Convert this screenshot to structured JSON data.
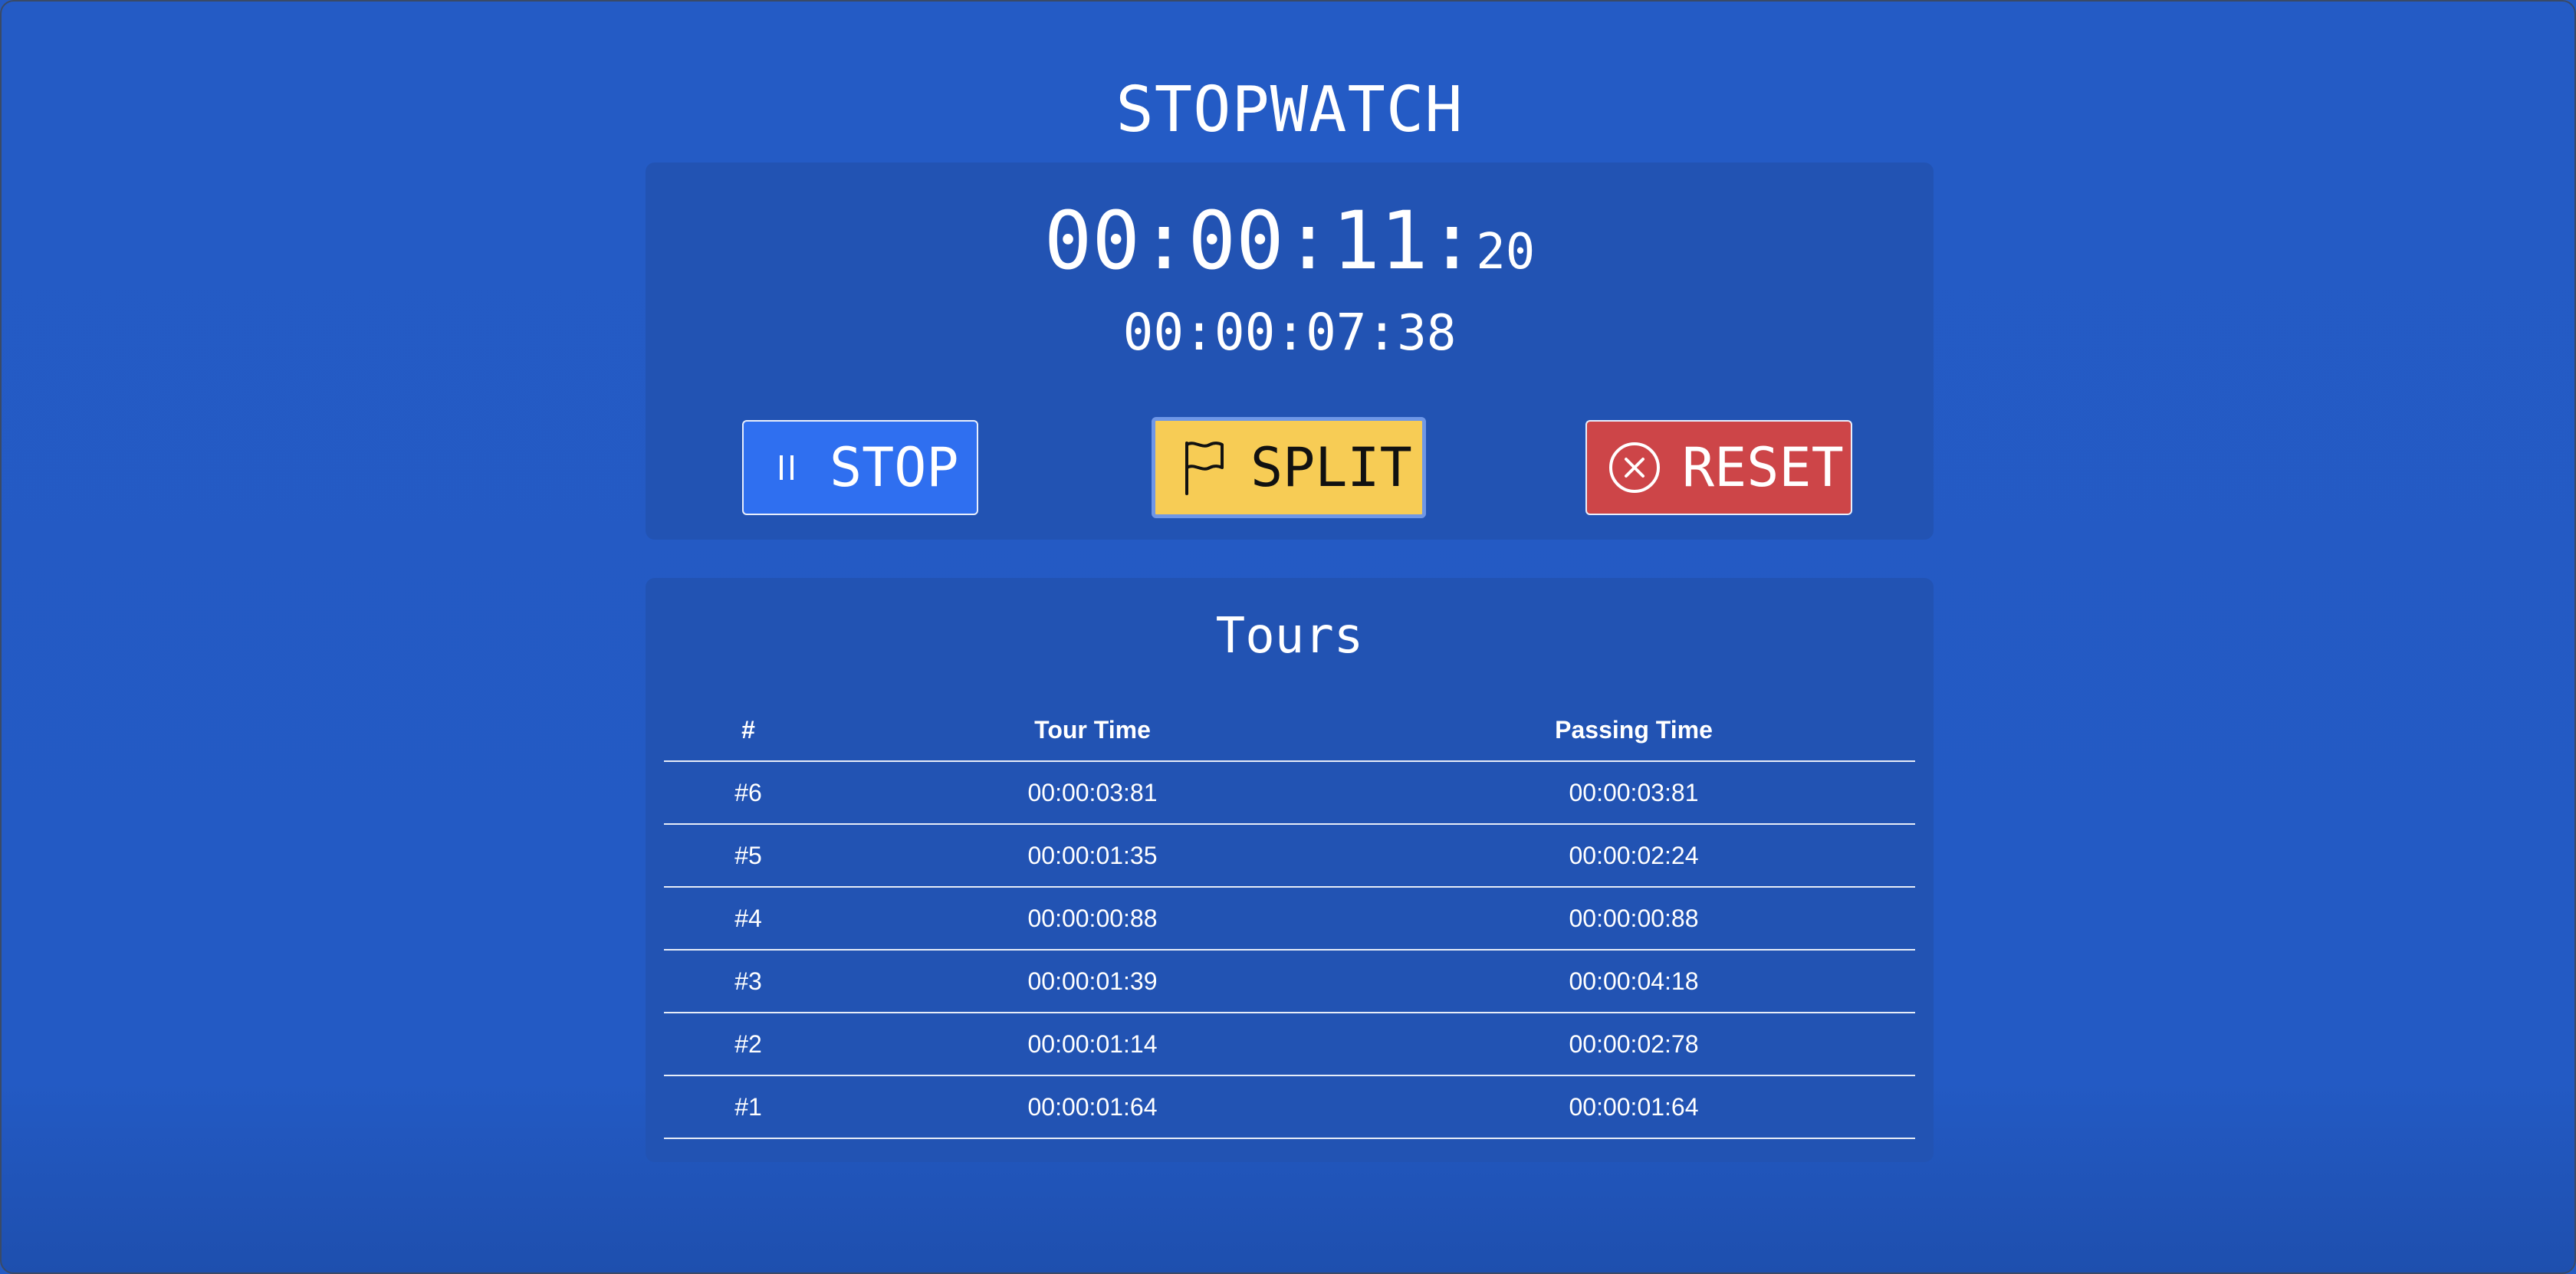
{
  "app": {
    "title": "STOPWATCH"
  },
  "timer": {
    "main_time": "00:00:11:",
    "main_ms": "20",
    "split_time": "00:00:07:",
    "split_ms": "38"
  },
  "buttons": {
    "stop_label": "STOP",
    "stop_icon": "pause-icon",
    "split_label": "SPLIT",
    "split_icon": "flag-icon",
    "reset_label": "RESET",
    "reset_icon": "circle-x-icon"
  },
  "tours": {
    "title": "Tours",
    "columns": [
      "#",
      "Tour Time",
      "Passing Time"
    ],
    "rows": [
      {
        "num": "#6",
        "tour": "00:00:03:81",
        "passing": "00:00:03:81"
      },
      {
        "num": "#5",
        "tour": "00:00:01:35",
        "passing": "00:00:02:24"
      },
      {
        "num": "#4",
        "tour": "00:00:00:88",
        "passing": "00:00:00:88"
      },
      {
        "num": "#3",
        "tour": "00:00:01:39",
        "passing": "00:00:04:18"
      },
      {
        "num": "#2",
        "tour": "00:00:01:14",
        "passing": "00:00:02:78"
      },
      {
        "num": "#1",
        "tour": "00:00:01:64",
        "passing": "00:00:01:64"
      }
    ]
  },
  "colors": {
    "background": "#235ac4",
    "card": "#2253b3",
    "stop_button": "#2f6ff0",
    "split_button": "#f7cc55",
    "reset_button": "#cd4548"
  }
}
